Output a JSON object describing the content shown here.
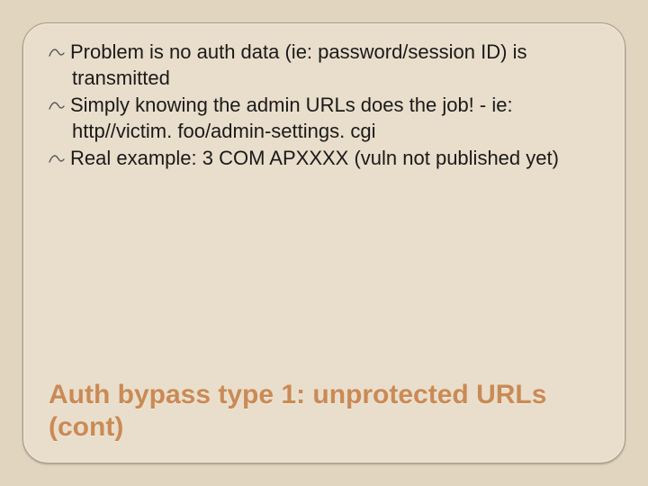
{
  "slide": {
    "bullets": [
      "Problem is no auth data (ie: password/session ID) is transmitted",
      "Simply knowing the admin URLs does the job! - ie: http//victim. foo/admin-settings. cgi",
      "Real example: 3 COM APXXXX (vuln not published yet)"
    ],
    "title": "Auth bypass type 1: unprotected URLs (cont)"
  }
}
